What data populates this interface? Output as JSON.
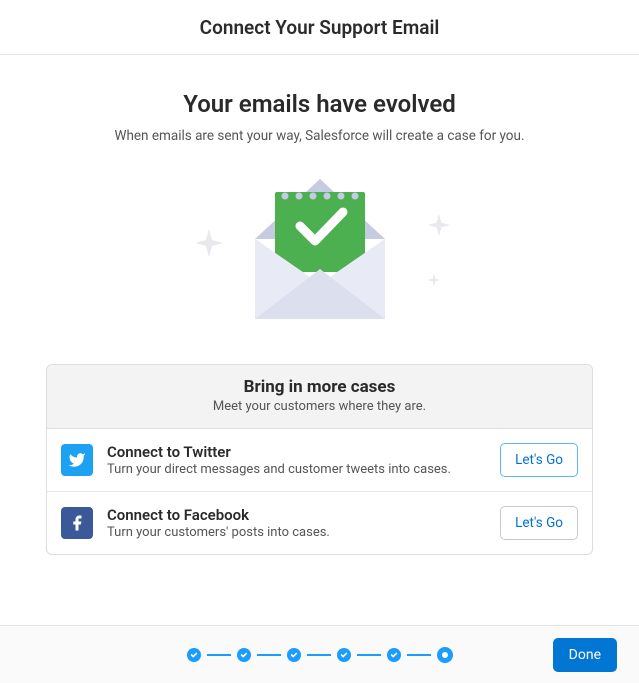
{
  "header": {
    "title": "Connect Your Support Email"
  },
  "main": {
    "title": "Your emails have evolved",
    "subtitle": "When emails are sent your way, Salesforce will create a case for you."
  },
  "cases_card": {
    "title": "Bring in more cases",
    "subtitle": "Meet your customers where they are.",
    "twitter": {
      "title": "Connect to Twitter",
      "subtitle": "Turn your direct messages and customer tweets into cases.",
      "button": "Let's Go"
    },
    "facebook": {
      "title": "Connect to Facebook",
      "subtitle": "Turn your customers' posts into cases.",
      "button": "Let's Go"
    }
  },
  "footer": {
    "done": "Done",
    "progress": {
      "total_steps": 6,
      "completed_steps": 5,
      "current_step": 6
    }
  },
  "colors": {
    "primary_blue": "#0176d3",
    "progress_blue": "#1b9cff",
    "twitter": "#1DA1F2",
    "facebook": "#3b5998"
  }
}
